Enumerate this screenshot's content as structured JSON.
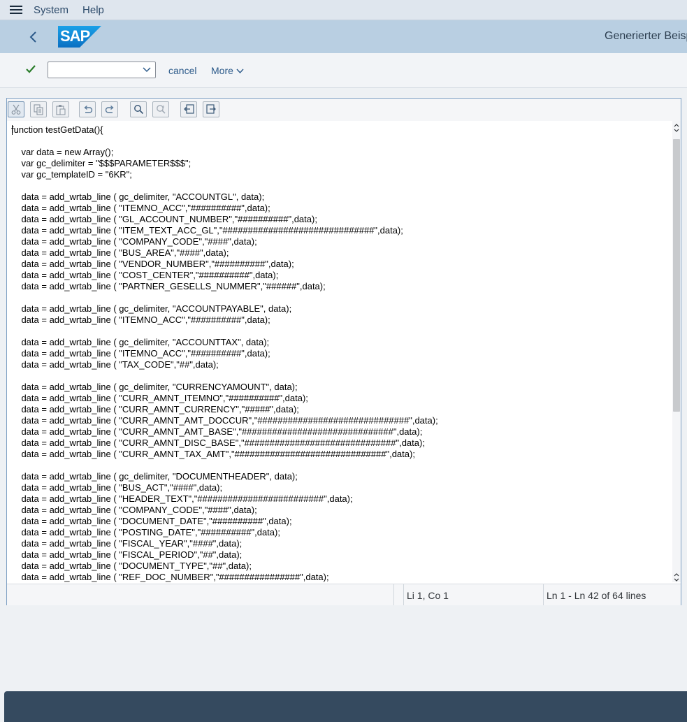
{
  "menu": {
    "items": [
      "System",
      "Help"
    ]
  },
  "shell": {
    "logo_text": "SAP",
    "title": "Generierter Beisp"
  },
  "toolbar": {
    "dropdown_value": "",
    "cancel_label": "cancel",
    "more_label": "More"
  },
  "editor": {
    "code": "function testGetData(){\n\n    var data = new Array();\n    var gc_delimiter = \"$$$PARAMETER$$$\";\n    var gc_templateID = \"6KR\";\n\n    data = add_wrtab_line ( gc_delimiter, \"ACCOUNTGL\", data);\n    data = add_wrtab_line ( \"ITEMNO_ACC\",\"##########\",data);\n    data = add_wrtab_line ( \"GL_ACCOUNT_NUMBER\",\"##########\",data);\n    data = add_wrtab_line ( \"ITEM_TEXT_ACC_GL\",\"##############################\",data);\n    data = add_wrtab_line ( \"COMPANY_CODE\",\"####\",data);\n    data = add_wrtab_line ( \"BUS_AREA\",\"####\",data);\n    data = add_wrtab_line ( \"VENDOR_NUMBER\",\"##########\",data);\n    data = add_wrtab_line ( \"COST_CENTER\",\"##########\",data);\n    data = add_wrtab_line ( \"PARTNER_GESELLS_NUMMER\",\"######\",data);\n\n    data = add_wrtab_line ( gc_delimiter, \"ACCOUNTPAYABLE\", data);\n    data = add_wrtab_line ( \"ITEMNO_ACC\",\"##########\",data);\n\n    data = add_wrtab_line ( gc_delimiter, \"ACCOUNTTAX\", data);\n    data = add_wrtab_line ( \"ITEMNO_ACC\",\"##########\",data);\n    data = add_wrtab_line ( \"TAX_CODE\",\"##\",data);\n\n    data = add_wrtab_line ( gc_delimiter, \"CURRENCYAMOUNT\", data);\n    data = add_wrtab_line ( \"CURR_AMNT_ITEMNO\",\"##########\",data);\n    data = add_wrtab_line ( \"CURR_AMNT_CURRENCY\",\"#####\",data);\n    data = add_wrtab_line ( \"CURR_AMNT_AMT_DOCCUR\",\"##############################\",data);\n    data = add_wrtab_line ( \"CURR_AMNT_AMT_BASE\",\"##############################\",data);\n    data = add_wrtab_line ( \"CURR_AMNT_DISC_BASE\",\"##############################\",data);\n    data = add_wrtab_line ( \"CURR_AMNT_TAX_AMT\",\"##############################\",data);\n\n    data = add_wrtab_line ( gc_delimiter, \"DOCUMENTHEADER\", data);\n    data = add_wrtab_line ( \"BUS_ACT\",\"####\",data);\n    data = add_wrtab_line ( \"HEADER_TEXT\",\"#########################\",data);\n    data = add_wrtab_line ( \"COMPANY_CODE\",\"####\",data);\n    data = add_wrtab_line ( \"DOCUMENT_DATE\",\"##########\",data);\n    data = add_wrtab_line ( \"POSTING_DATE\",\"##########\",data);\n    data = add_wrtab_line ( \"FISCAL_YEAR\",\"####\",data);\n    data = add_wrtab_line ( \"FISCAL_PERIOD\",\"##\",data);\n    data = add_wrtab_line ( \"DOCUMENT_TYPE\",\"##\",data);\n    data = add_wrtab_line ( \"REF_DOC_NUMBER\",\"################\",data);",
    "status_position": "Li 1, Co 1",
    "status_lines": "Ln 1 - Ln 42 of 64 lines"
  },
  "colors": {
    "shell_bg": "#b9cfe2",
    "accent": "#2c5a8a",
    "check": "#2b7d2b",
    "footer": "#354a5f"
  }
}
